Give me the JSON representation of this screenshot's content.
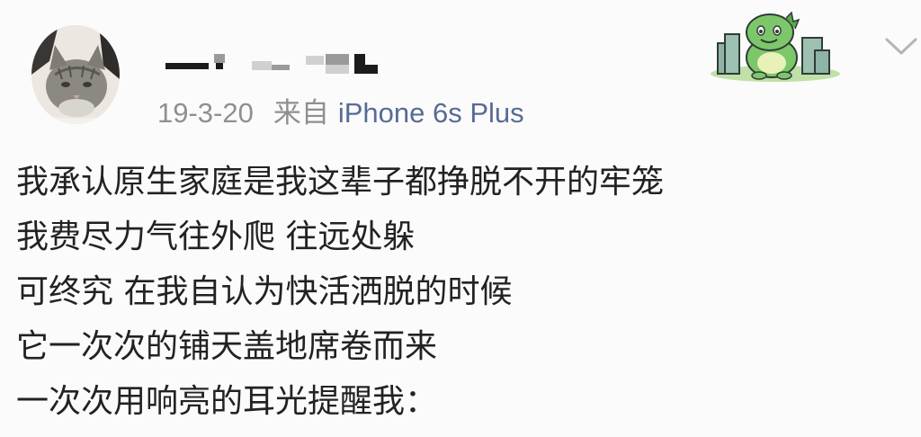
{
  "post": {
    "user": {
      "avatar_icon": "cat-avatar-icon",
      "name_redacted": true
    },
    "meta": {
      "date": "19-3-20",
      "source_prefix": "来自",
      "device": "iPhone 6s Plus"
    },
    "sticker_icon": "green-dinosaur-sticker-icon",
    "menu_icon": "chevron-down-icon",
    "lines": [
      "我承认原生家庭是我这辈子都挣脱不开的牢笼",
      "我费尽力气往外爬 往远处躲",
      "可终究 在我自认为快活洒脱的时候",
      "它一次次的铺天盖地席卷而来",
      "一次次用响亮的耳光提醒我："
    ]
  },
  "colors": {
    "meta_text": "#8f8f8f",
    "device_link": "#576b95",
    "body_text": "#222222",
    "background": "#fbfbfb"
  }
}
